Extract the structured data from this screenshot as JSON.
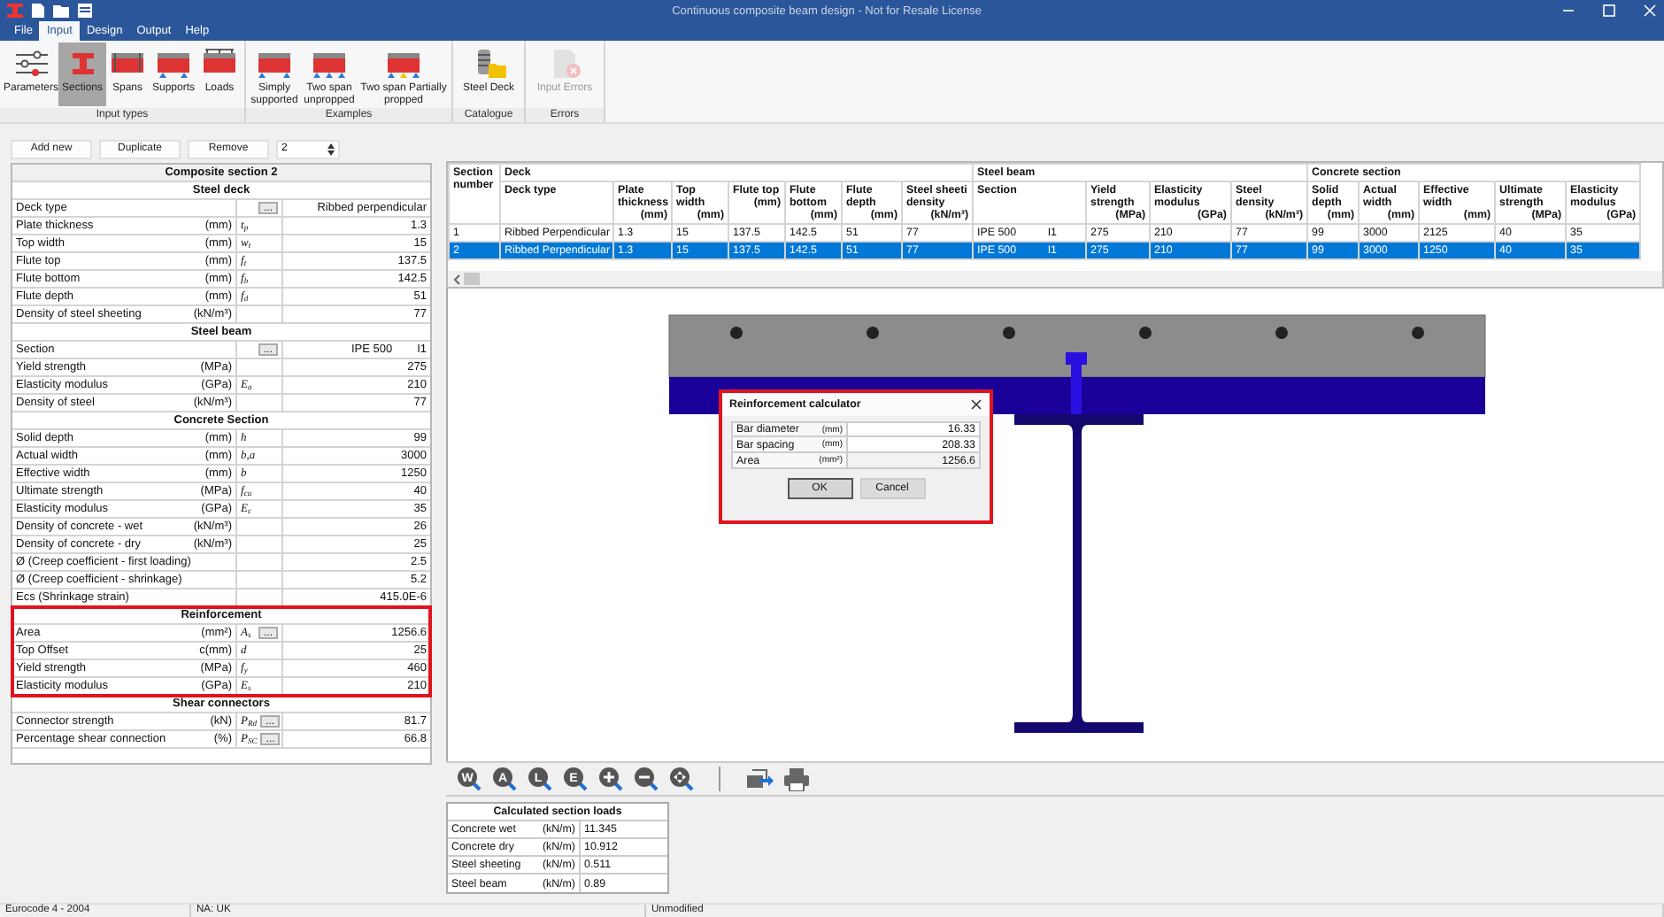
{
  "window": {
    "title": "Continuous composite beam design - Not for Resale License"
  },
  "menu": [
    {
      "label": "File",
      "selected": false
    },
    {
      "label": "Input",
      "selected": true
    },
    {
      "label": "Design",
      "selected": false
    },
    {
      "label": "Output",
      "selected": false
    },
    {
      "label": "Help",
      "selected": false
    }
  ],
  "ribbon": {
    "groups": [
      {
        "label": "Input types",
        "items": [
          {
            "label": "Parameters",
            "kind": "sliders",
            "selected": false,
            "disabled": false
          },
          {
            "label": "Sections",
            "kind": "i-section",
            "selected": true,
            "disabled": false
          },
          {
            "label": "Spans",
            "kind": "span",
            "selected": false,
            "disabled": false
          },
          {
            "label": "Supports",
            "kind": "supports",
            "selected": false,
            "disabled": false
          },
          {
            "label": "Loads",
            "kind": "loads",
            "selected": false,
            "disabled": false
          }
        ]
      },
      {
        "label": "Examples",
        "items": [
          {
            "label": "Simply supported",
            "kind": "simple",
            "selected": false,
            "disabled": false
          },
          {
            "label": "Two span unpropped",
            "kind": "two-span",
            "selected": false,
            "disabled": false
          },
          {
            "label": "Two span Partially propped",
            "kind": "propped",
            "selected": false,
            "disabled": false
          }
        ]
      },
      {
        "label": "Catalogue",
        "items": [
          {
            "label": "Steel Deck",
            "kind": "deck",
            "selected": false,
            "disabled": false
          }
        ]
      },
      {
        "label": "Errors",
        "items": [
          {
            "label": "Input Errors",
            "kind": "errors",
            "selected": false,
            "disabled": true
          }
        ]
      }
    ]
  },
  "section_toolbar": {
    "buttons": [
      "Add new",
      "Duplicate",
      "Remove"
    ],
    "spin_value": "2"
  },
  "property_grid": {
    "title": "Composite section 2",
    "groups": [
      {
        "title": "Steel deck",
        "highlighted": false,
        "rows": [
          {
            "label": "Deck type",
            "button": "...",
            "value": "Ribbed perpendicular"
          },
          {
            "label": "Plate thickness",
            "unit": "(mm)",
            "symbol": "t$_{p}$",
            "value": "1.3"
          },
          {
            "label": "Top width",
            "unit": "(mm)",
            "symbol": "w$_{t}$",
            "value": "15"
          },
          {
            "label": "Flute top",
            "unit": "(mm)",
            "symbol": "f$_{t}$",
            "value": "137.5"
          },
          {
            "label": "Flute bottom",
            "unit": "(mm)",
            "symbol": "f$_{b}$",
            "value": "142.5"
          },
          {
            "label": "Flute depth",
            "unit": "(mm)",
            "symbol": "f$_{d}$",
            "value": "51"
          },
          {
            "label": "Density of steel sheeting",
            "unit": "(kN/m³)",
            "value": "77"
          }
        ]
      },
      {
        "title": "Steel beam",
        "highlighted": false,
        "rows": [
          {
            "label": "Section",
            "button": "...",
            "value": "IPE 500",
            "suffix": "I1"
          },
          {
            "label": "Yield strength",
            "unit": "(MPa)",
            "value": "275"
          },
          {
            "label": "Elasticity modulus",
            "unit": "(GPa)",
            "symbol": "E$_{a}$",
            "value": "210"
          },
          {
            "label": "Density of steel",
            "unit": "(kN/m³)",
            "value": "77"
          }
        ]
      },
      {
        "title": "Concrete Section",
        "highlighted": false,
        "rows": [
          {
            "label": "Solid depth",
            "unit": "(mm)",
            "symbol": "h",
            "value": "99"
          },
          {
            "label": "Actual width",
            "unit": "(mm)",
            "symbol": "b,a",
            "value": "3000"
          },
          {
            "label": "Effective width",
            "unit": "(mm)",
            "symbol": "b",
            "value": "1250"
          },
          {
            "label": "Ultimate strength",
            "unit": "(MPa)",
            "symbol": "f$_{cu}$",
            "value": "40"
          },
          {
            "label": "Elasticity modulus",
            "unit": "(GPa)",
            "symbol": "E$_{c}$",
            "value": "35"
          },
          {
            "label": "Density of concrete - wet",
            "unit": "(kN/m³)",
            "value": "26"
          },
          {
            "label": "Density of concrete - dry",
            "unit": "(kN/m³)",
            "value": "25"
          },
          {
            "label": "Ø (Creep coefficient - first loading)",
            "value": "2.5"
          },
          {
            "label": "Ø (Creep coefficient - shrinkage)",
            "value": "5.2"
          },
          {
            "label": "Ecs (Shrinkage strain)",
            "value": "415.0E-6"
          }
        ]
      },
      {
        "title": "Reinforcement",
        "highlighted": true,
        "rows": [
          {
            "label": "Area",
            "unit": "(mm²)",
            "symbol": "A$_{s}$",
            "button": "...",
            "value": "1256.6"
          },
          {
            "label": "Top Offset",
            "unit": "c(mm)",
            "symbol": "d",
            "value": "25"
          },
          {
            "label": "Yield strength",
            "unit": "(MPa)",
            "symbol": "f$_{y}$",
            "value": "460"
          },
          {
            "label": "Elasticity modulus",
            "unit": "(GPa)",
            "symbol": "E$_{s}$",
            "value": "210"
          }
        ]
      },
      {
        "title": "Shear connectors",
        "highlighted": false,
        "rows": [
          {
            "label": "Connector strength",
            "unit": "(kN)",
            "symbol": "P$_{Rd}$",
            "button": "...",
            "value": "81.7"
          },
          {
            "label": "Percentage shear connection",
            "unit": "(%)",
            "symbol": "P$_{SC}$",
            "button": "...",
            "value": "66.8"
          }
        ]
      }
    ]
  },
  "table": {
    "index_column": {
      "label": "Section number"
    },
    "groups": [
      {
        "label": "Deck",
        "columns": [
          {
            "label": "Deck type"
          },
          {
            "label": "Plate thickness",
            "unit": "(mm)"
          },
          {
            "label": "Top width",
            "unit": "(mm)"
          },
          {
            "label": "Flute top",
            "unit": "(mm)"
          },
          {
            "label": "Flute bottom",
            "unit": "(mm)"
          },
          {
            "label": "Flute depth",
            "unit": "(mm)"
          },
          {
            "label": "Steel sheeti density",
            "unit": "(kN/m³)"
          }
        ]
      },
      {
        "label": "Steel beam",
        "columns": [
          {
            "label": "Section"
          },
          {
            "label": "Yield strength",
            "unit": "(MPa)"
          },
          {
            "label": "Elasticity modulus",
            "unit": "(GPa)"
          },
          {
            "label": "Steel density",
            "unit": "(kN/m³)"
          }
        ]
      },
      {
        "label": "Concrete section",
        "columns": [
          {
            "label": "Solid depth",
            "unit": "(mm)"
          },
          {
            "label": "Actual width",
            "unit": "(mm)"
          },
          {
            "label": "Effective width",
            "unit": "(mm)"
          },
          {
            "label": "Ultimate strength",
            "unit": "(MPa)"
          },
          {
            "label": "Elasticity modulus",
            "unit": "(GPa)"
          }
        ]
      }
    ],
    "rows": [
      {
        "number": "1",
        "selected": false,
        "cells": [
          "Ribbed Perpendicular",
          "1.3",
          "15",
          "137.5",
          "142.5",
          "51",
          "77",
          [
            "IPE 500",
            "I1"
          ],
          "275",
          "210",
          "77",
          "99",
          "3000",
          "2125",
          "40",
          "35"
        ]
      },
      {
        "number": "2",
        "selected": true,
        "cells": [
          "Ribbed Perpendicular",
          "1.3",
          "15",
          "137.5",
          "142.5",
          "51",
          "77",
          [
            "IPE 500",
            "I1"
          ],
          "275",
          "210",
          "77",
          "99",
          "3000",
          "1250",
          "40",
          "35"
        ]
      }
    ]
  },
  "dialog": {
    "title": "Reinforcement calculator",
    "highlighted": true,
    "rows": [
      {
        "label": "Bar diameter",
        "unit": "(mm)",
        "value": "16.33",
        "editable": true
      },
      {
        "label": "Bar spacing",
        "unit": "(mm)",
        "value": "208.33",
        "editable": true
      },
      {
        "label": "Area",
        "unit": "(mm²)",
        "value": "1256.6",
        "editable": false
      }
    ],
    "buttons": [
      {
        "label": "OK",
        "default": true
      },
      {
        "label": "Cancel",
        "default": false
      }
    ]
  },
  "view_toolbar": {
    "tools": [
      {
        "kind": "zoom",
        "letter": "W"
      },
      {
        "kind": "zoom",
        "letter": "A"
      },
      {
        "kind": "zoom",
        "letter": "L"
      },
      {
        "kind": "zoom",
        "letter": "E"
      },
      {
        "kind": "zoom-in"
      },
      {
        "kind": "zoom-out"
      },
      {
        "kind": "zoom-fit"
      },
      {
        "kind": "separator"
      },
      {
        "kind": "export"
      },
      {
        "kind": "print"
      }
    ]
  },
  "loads": {
    "title": "Calculated section loads",
    "rows": [
      {
        "label": "Concrete wet",
        "unit": "(kN/m)",
        "value": "11.345"
      },
      {
        "label": "Concrete dry",
        "unit": "(kN/m)",
        "value": "10.912"
      },
      {
        "label": "Steel sheeting",
        "unit": "(kN/m)",
        "value": "0.511"
      },
      {
        "label": "Steel beam",
        "unit": "(kN/m)",
        "value": "0.89"
      }
    ]
  },
  "status_bar": [
    "Eurocode 4 - 2004",
    "NA: UK",
    "Unmodified"
  ]
}
